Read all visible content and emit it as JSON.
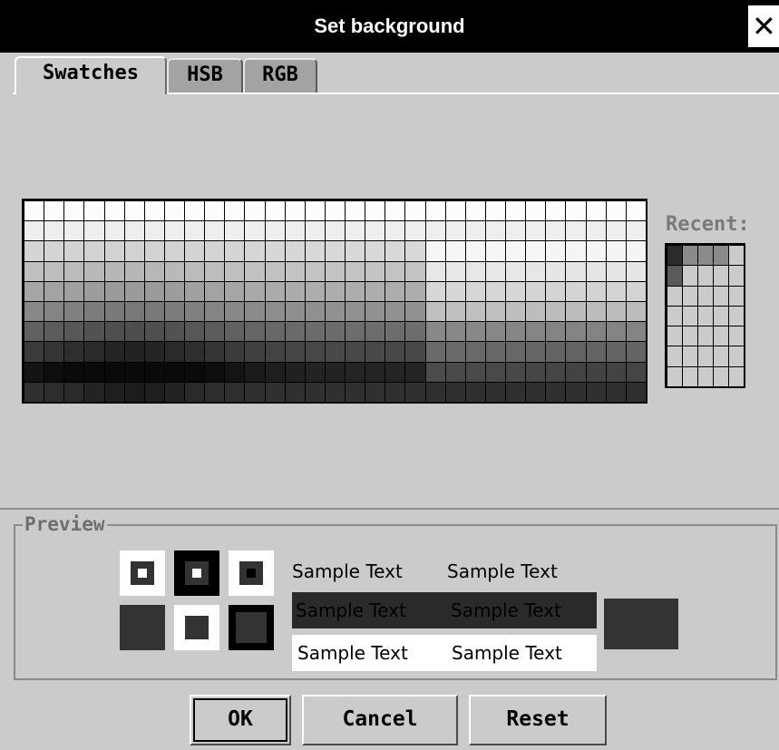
{
  "window": {
    "title": "Set background",
    "close_glyph": "✕"
  },
  "tabs": [
    {
      "label": "Swatches",
      "active": true
    },
    {
      "label": "HSB",
      "active": false
    },
    {
      "label": "RGB",
      "active": false
    }
  ],
  "swatches": {
    "columns": 31,
    "rows": 10
  },
  "recent": {
    "label": "Recent:",
    "columns": 5,
    "rows": 7,
    "colors": [
      "#2b2b2b",
      "#8a8a8a",
      "#8a8a8a",
      "#8a8a8a",
      "#cbcbcb",
      "#5a5a5a"
    ]
  },
  "preview": {
    "label": "Preview",
    "sample_text": "Sample Text",
    "selected_color": "#333333"
  },
  "buttons": {
    "ok": "OK",
    "cancel": "Cancel",
    "reset": "Reset"
  }
}
